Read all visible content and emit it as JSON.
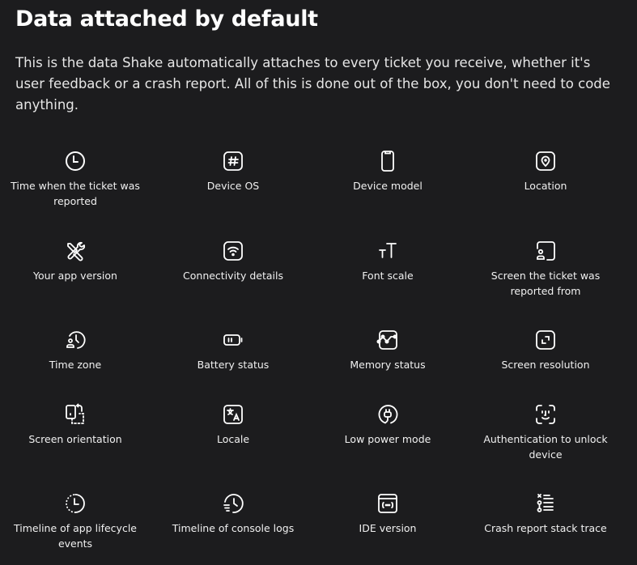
{
  "header": {
    "title": "Data attached by default",
    "description": "This is the data Shake automatically attaches to every ticket you receive, whether it's user feedback or a crash report. All of this is done out of the box, you don't need to code anything."
  },
  "colors": {
    "background": "#1c1c1e",
    "text": "#ffffff"
  },
  "items": [
    {
      "label": "Time when the ticket was reported",
      "icon": "clock-icon"
    },
    {
      "label": "Device OS",
      "icon": "hash-icon"
    },
    {
      "label": "Device model",
      "icon": "phone-icon"
    },
    {
      "label": "Location",
      "icon": "location-pin-icon"
    },
    {
      "label": "Your app version",
      "icon": "tools-icon"
    },
    {
      "label": "Connectivity details",
      "icon": "wifi-icon"
    },
    {
      "label": "Font scale",
      "icon": "font-size-icon"
    },
    {
      "label": "Screen the ticket was reported from",
      "icon": "screen-user-icon"
    },
    {
      "label": "Time zone",
      "icon": "user-clock-icon"
    },
    {
      "label": "Battery status",
      "icon": "battery-icon"
    },
    {
      "label": "Memory status",
      "icon": "chart-icon"
    },
    {
      "label": "Screen resolution",
      "icon": "resize-icon"
    },
    {
      "label": "Screen orientation",
      "icon": "rotate-screen-icon"
    },
    {
      "label": "Locale",
      "icon": "translate-icon"
    },
    {
      "label": "Low power mode",
      "icon": "plug-icon"
    },
    {
      "label": "Authentication to unlock device",
      "icon": "face-id-icon"
    },
    {
      "label": "Timeline of app lifecycle events",
      "icon": "dashed-clock-icon"
    },
    {
      "label": "Timeline of console logs",
      "icon": "log-clock-icon"
    },
    {
      "label": "IDE version",
      "icon": "code-window-icon"
    },
    {
      "label": "Crash report stack trace",
      "icon": "stack-trace-icon"
    }
  ]
}
